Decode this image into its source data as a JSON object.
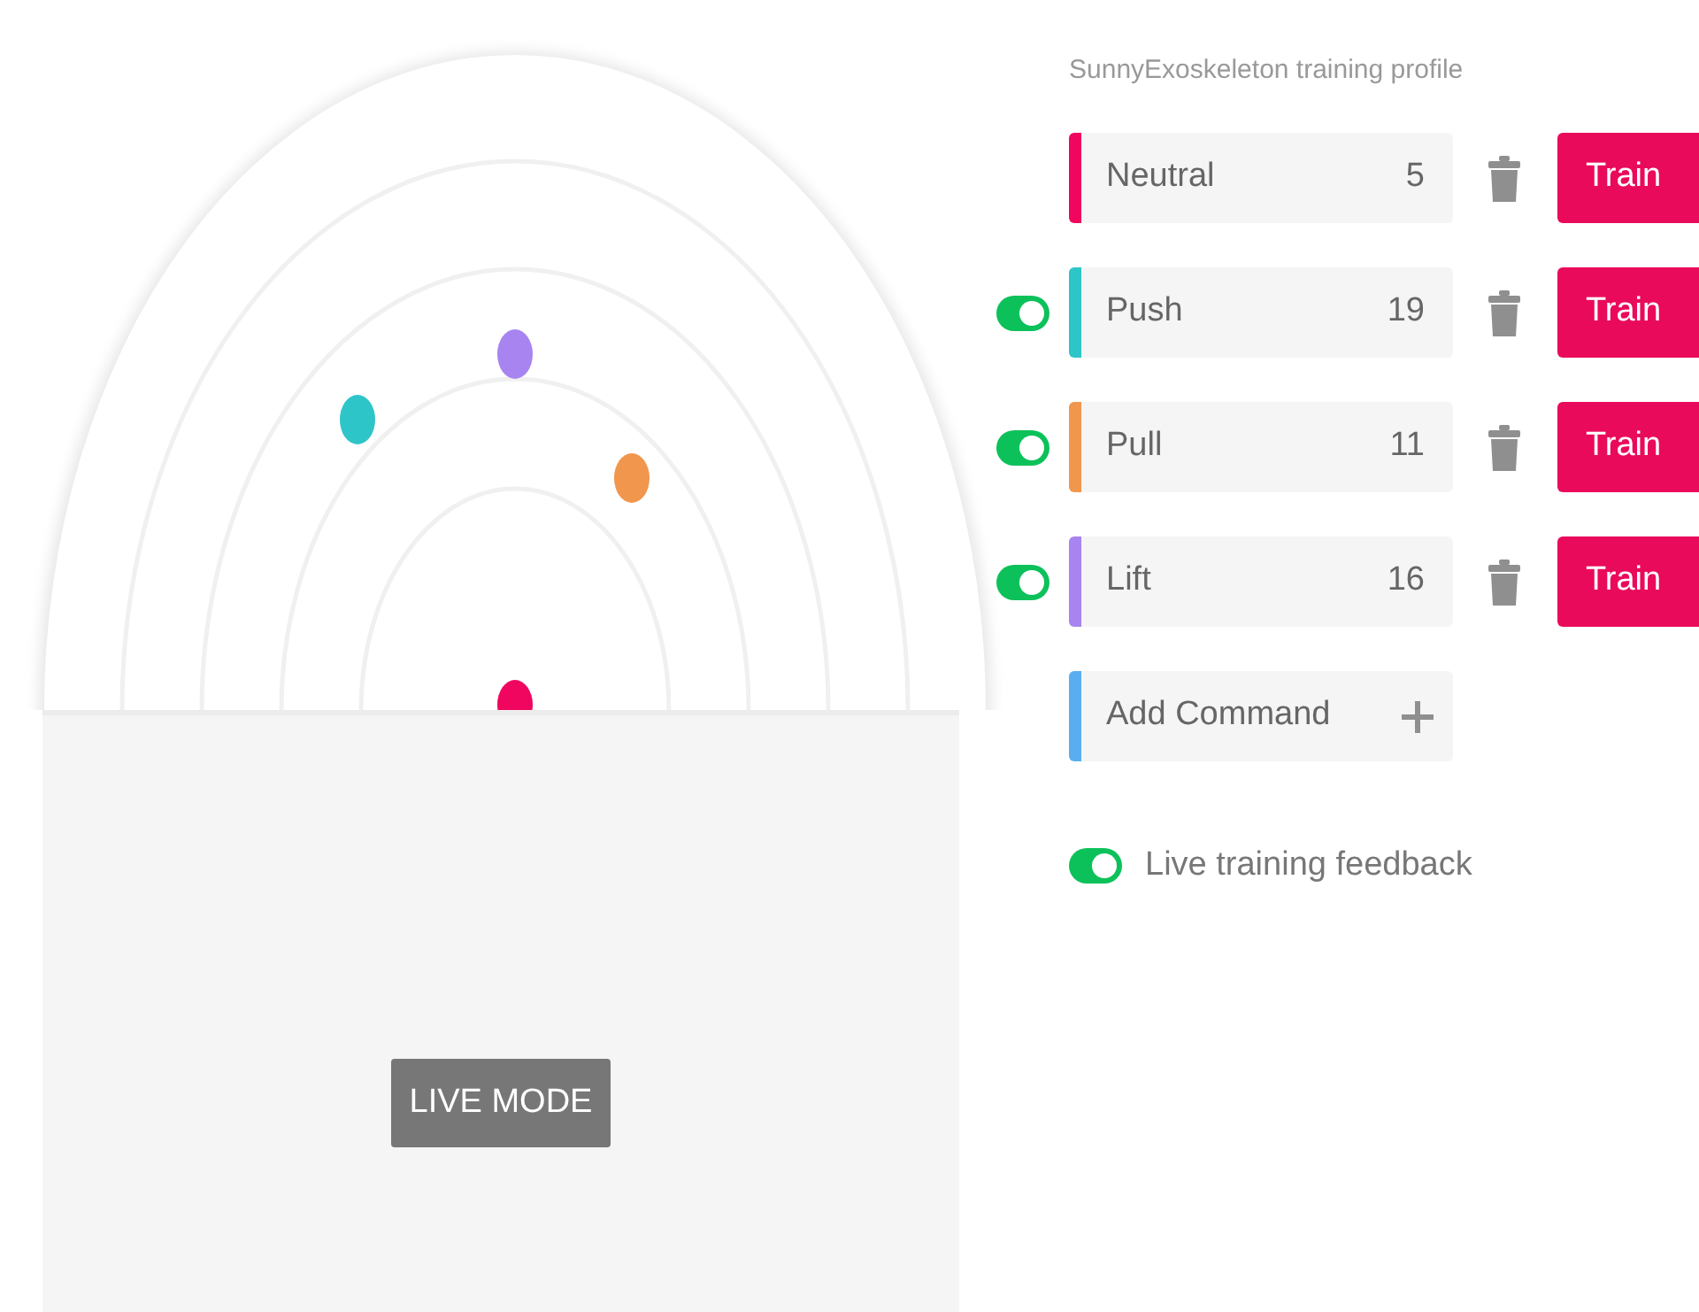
{
  "profile_title": "SunnyExoskeleton training profile",
  "commands": [
    {
      "kind": "neutral",
      "name": "Neutral",
      "count": "5",
      "color": "#f0065f",
      "train": "Train"
    },
    {
      "kind": "command",
      "name": "Push",
      "count": "19",
      "color": "#2ec5c8",
      "on": true,
      "train": "Train"
    },
    {
      "kind": "command",
      "name": "Pull",
      "count": "11",
      "color": "#f0964d",
      "on": true,
      "train": "Train"
    },
    {
      "kind": "command",
      "name": "Lift",
      "count": "16",
      "color": "#a884f0",
      "on": true,
      "train": "Train"
    }
  ],
  "add_command": {
    "label": "Add Command",
    "color": "#5aaef0"
  },
  "live_feedback": {
    "label": "Live training feedback",
    "on": true
  },
  "live_mode_button": "LIVE MODE"
}
